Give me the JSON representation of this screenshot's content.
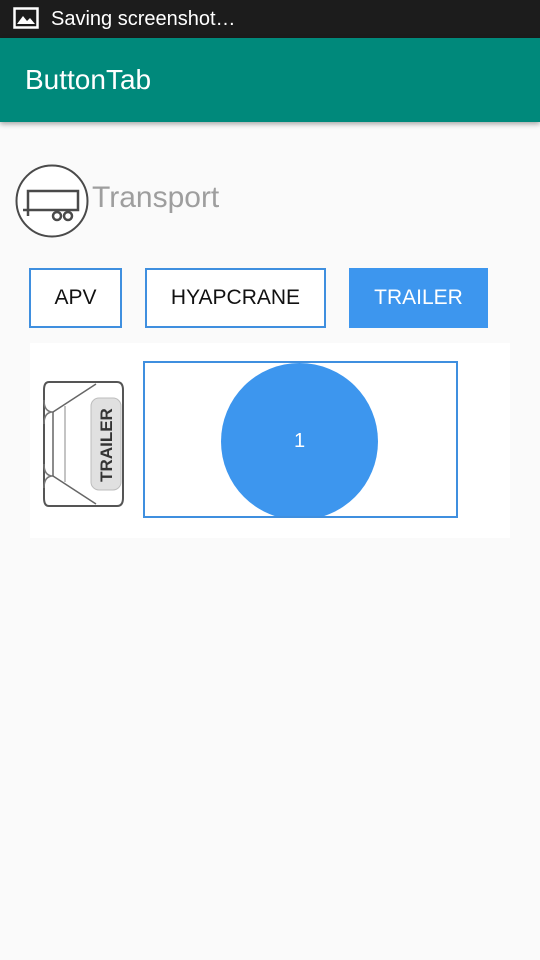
{
  "status_bar": {
    "notification_icon": "image-icon",
    "text": "Saving screenshot…"
  },
  "app_bar": {
    "title": "ButtonTab"
  },
  "section": {
    "icon": "trailer-icon",
    "label": "Transport"
  },
  "tabs": [
    {
      "label": "APV",
      "active": false
    },
    {
      "label": "HYAPCRANE",
      "active": false
    },
    {
      "label": "TRAILER",
      "active": true
    }
  ],
  "content": {
    "vehicle_image": "trailer-top-view-image",
    "vehicle_image_text": "TRAILER",
    "slot_number": "1"
  },
  "colors": {
    "status_bar": "#1c1c1c",
    "app_bar": "#00897b",
    "accent": "#3d96ee",
    "tab_border": "#3f8fdf",
    "background": "#fafafa"
  }
}
